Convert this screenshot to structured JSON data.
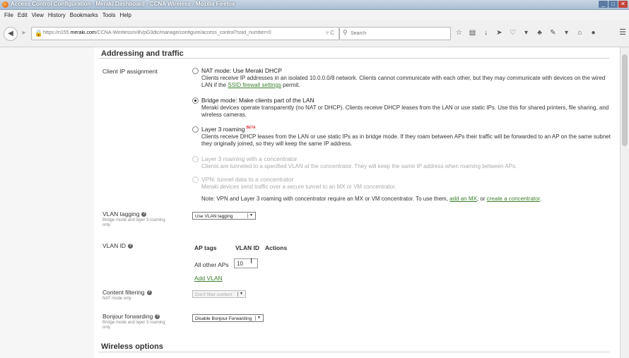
{
  "window": {
    "title": "Access Control Configuration - Meraki Dashboard - CCNA Wireless - Mozilla Firefox",
    "buttons": {
      "minimize": "_",
      "maximize": "□",
      "close": "✕"
    }
  },
  "menu": [
    "File",
    "Edit",
    "View",
    "History",
    "Bookmarks",
    "Tools",
    "Help"
  ],
  "nav": {
    "url_prefix": "https://n155.",
    "url_host": "meraki.com",
    "url_path": "/CCNA-Wireless/n/8VpG3dlc/manage/configure/access_control?ssid_number=0",
    "search_placeholder": "Search"
  },
  "addressing": {
    "title": "Addressing and traffic",
    "client_ip_label": "Client IP assignment",
    "options": [
      {
        "title": "NAT mode: Use Meraki DHCP",
        "desc_a": "Clients receive IP addresses in an isolated 10.0.0.0/8 network. Clients cannot communicate with each other, but they may communicate with devices on the wired LAN if the ",
        "link": "SSID firewall settings",
        "desc_b": " permit.",
        "selected": false,
        "disabled": false
      },
      {
        "title": "Bridge mode: Make clients part of the LAN",
        "desc": "Meraki devices operate transparently (no NAT or DHCP). Clients receive DHCP leases from the LAN or use static IPs. Use this for shared printers, file sharing, and wireless cameras.",
        "selected": true,
        "disabled": false
      },
      {
        "title": "Layer 3 roaming",
        "badge": "BETA",
        "desc": "Clients receive DHCP leases from the LAN or use static IPs as in bridge mode. If they roam between APs their traffic will be forwarded to an AP on the same subnet they originally joined, so they will keep the same IP address.",
        "selected": false,
        "disabled": false
      },
      {
        "title": "Layer 3 roaming with a concentrator",
        "desc": "Clients are tunneled to a specified VLAN at the concentrator. They will keep the same IP address when roaming between APs.",
        "selected": false,
        "disabled": true
      },
      {
        "title": "VPN: tunnel data to a concentrator",
        "desc": "Meraki devices send traffic over a secure tunnel to an MX or VM concentrator.",
        "selected": false,
        "disabled": true
      }
    ],
    "note_text": "Note: VPN and Layer 3 roaming with concentrator require an MX or VM concentrator. To use them, ",
    "note_link1": "add an MX",
    "note_mid": ", or ",
    "note_link2": "create a concentrator",
    "note_end": "."
  },
  "vlan_tagging": {
    "label": "VLAN tagging",
    "sub": "Bridge mode and layer 3 roaming only",
    "value": "Use VLAN tagging"
  },
  "vlan_id": {
    "label": "VLAN ID",
    "headers": [
      "AP tags",
      "VLAN ID",
      "Actions"
    ],
    "row_label": "All other APs",
    "row_value": "10",
    "add_link": "Add VLAN"
  },
  "content_filtering": {
    "label": "Content filtering",
    "sub": "NAT mode only",
    "value": "Don't filter content"
  },
  "bonjour": {
    "label": "Bonjour forwarding",
    "sub": "Bridge mode and layer 3 roaming only",
    "value": "Disable Bonjour Forwarding"
  },
  "wireless": {
    "title": "Wireless options"
  }
}
